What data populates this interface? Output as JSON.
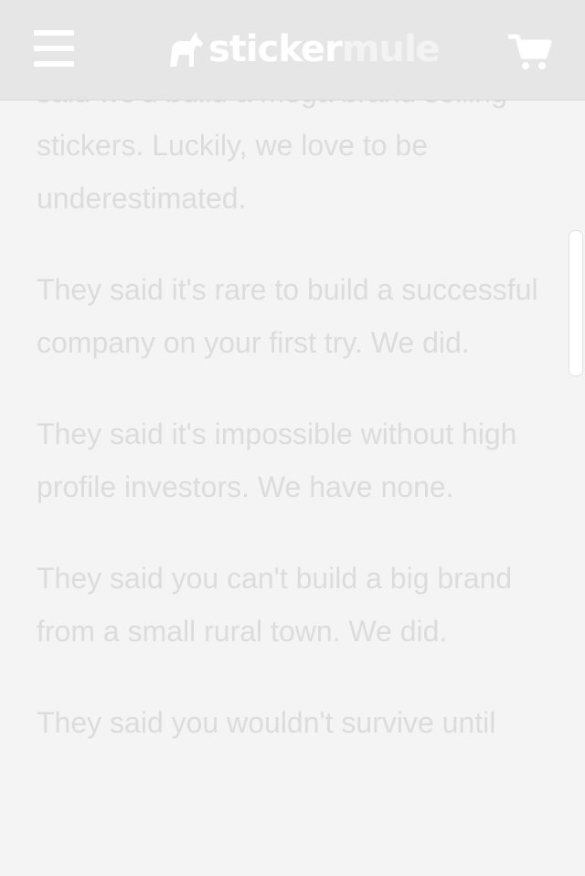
{
  "header": {
    "menu_icon": "hamburger-menu-icon",
    "logo": {
      "part1": "sticker",
      "part2": "mule",
      "mark_icon": "mule-icon"
    },
    "cart_icon": "shopping-cart-icon"
  },
  "article": {
    "paragraphs": [
      "said we'd build a mega brand selling stickers. Luckily, we love to be underestimated.",
      "They said it's rare to build a successful company on your first try. We did.",
      "They said it's impossible without high profile investors. We have none.",
      "They said you can't build a big brand from a small rural town. We did.",
      "They said you wouldn't survive until"
    ]
  },
  "colors": {
    "header_bg": "#e6e6e6",
    "page_bg": "#f4f4f4",
    "text": "#dcdcdc"
  }
}
